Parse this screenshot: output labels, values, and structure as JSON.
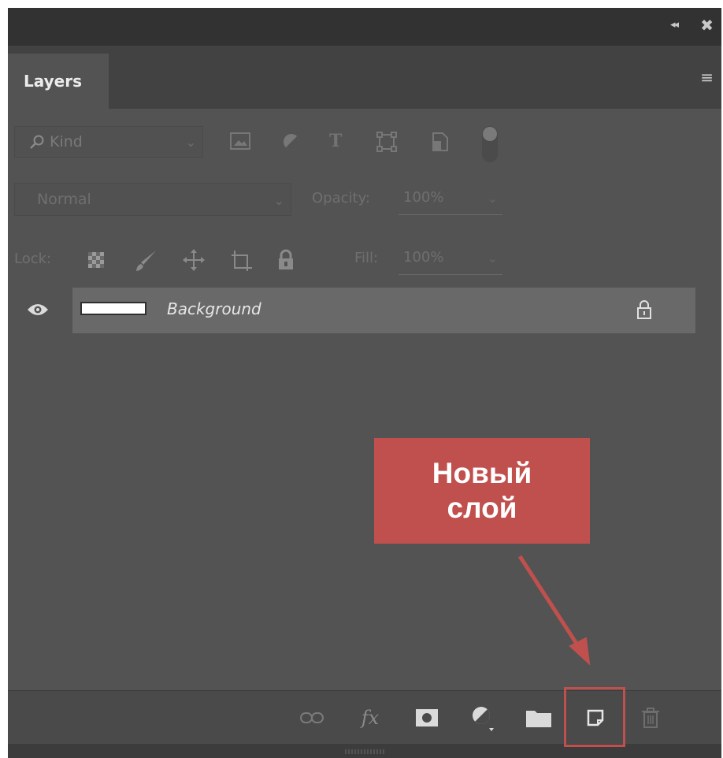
{
  "titlebar": {
    "collapse_glyph": "◂◂",
    "close_glyph": "✖"
  },
  "tabs": [
    {
      "label": "Layers"
    }
  ],
  "panel_menu_glyph": "≡",
  "filter": {
    "search_icon": "search-icon",
    "kind_label": "Kind",
    "filter_icons": [
      "image-filter-icon",
      "adjustment-filter-icon",
      "type-filter-icon",
      "shape-filter-icon",
      "smart-object-filter-icon"
    ]
  },
  "blend": {
    "mode": "Normal",
    "opacity_label": "Opacity:",
    "opacity_value": "100%"
  },
  "lock": {
    "label": "Lock:",
    "icons": [
      "lock-transparent-icon",
      "lock-image-icon",
      "lock-position-icon",
      "lock-artboard-icon",
      "lock-all-icon"
    ],
    "fill_label": "Fill:",
    "fill_value": "100%"
  },
  "layers": [
    {
      "name": "Background",
      "visible": true,
      "locked": true
    }
  ],
  "footer_buttons": [
    "link-layers-icon",
    "fx-icon",
    "layer-mask-icon",
    "adjustment-layer-icon",
    "group-folder-icon",
    "new-layer-icon",
    "trash-icon"
  ],
  "footer_fx_label": "fx",
  "callout": {
    "line1": "Новый",
    "line2": "слой",
    "color": "#c0504d"
  },
  "colors": {
    "panel_bg": "#535353",
    "titlebar_bg": "#323232",
    "layer_selected": "#696969",
    "accent": "#c0504d"
  }
}
